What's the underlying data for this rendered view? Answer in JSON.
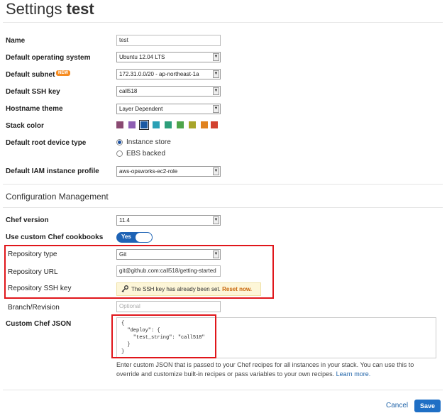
{
  "header": {
    "title_prefix": "Settings",
    "title_name": "test"
  },
  "fields": {
    "name": {
      "label": "Name",
      "value": "test"
    },
    "os": {
      "label": "Default operating system",
      "value": "Ubuntu 12.04 LTS"
    },
    "subnet": {
      "label": "Default subnet",
      "badge": "NEW",
      "value": "172.31.0.0/20 - ap-northeast-1a"
    },
    "ssh_key": {
      "label": "Default SSH key",
      "value": "call518"
    },
    "hostname": {
      "label": "Hostname theme",
      "value": "Layer Dependent"
    },
    "stack_color": {
      "label": "Stack color",
      "colors": [
        "#8a4a72",
        "#8e5fb3",
        "#1a5aa3",
        "#2aa0b5",
        "#2d9e7a",
        "#4ea54a",
        "#a8a52a",
        "#e0831f",
        "#d2422f"
      ],
      "selected_index": 2
    },
    "root_device": {
      "label": "Default root device type",
      "options": [
        "Instance store",
        "EBS backed"
      ],
      "selected": "Instance store"
    },
    "iam": {
      "label": "Default IAM instance profile",
      "value": "aws-opsworks-ec2-role"
    }
  },
  "config": {
    "section_title": "Configuration Management",
    "chef_version": {
      "label": "Chef version",
      "value": "11.4"
    },
    "custom_cookbooks": {
      "label": "Use custom Chef cookbooks",
      "toggle_label": "Yes",
      "enabled": true
    },
    "repo_type": {
      "label": "Repository type",
      "value": "Git"
    },
    "repo_url": {
      "label": "Repository URL",
      "value": "git@github.com:call518/getting-started"
    },
    "repo_ssh_key": {
      "label": "Repository SSH key",
      "message": "The SSH key has already been set.",
      "reset_link": "Reset now."
    },
    "branch": {
      "label": "Branch/Revision",
      "placeholder": "Optional"
    },
    "custom_json": {
      "label": "Custom Chef JSON",
      "value": "{\n  \"deploy\": {\n    \"test_string\": \"call518\"\n  }\n}",
      "help": "Enter custom JSON that is passed to your Chef recipes for all instances in your stack. You can use this to override and customize built-in recipes or pass variables to your own recipes.",
      "help_link": "Learn more."
    }
  },
  "footer": {
    "cancel_label": "Cancel",
    "save_label": "Save"
  }
}
